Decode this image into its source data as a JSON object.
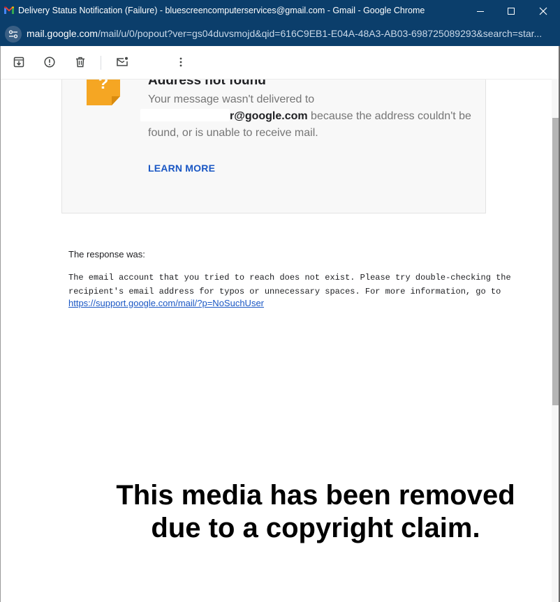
{
  "window": {
    "title": "Delivery Status Notification (Failure) - bluescreencomputerservices@gmail.com - Gmail - Google Chrome",
    "url_host": "mail.google.com",
    "url_path": "/mail/u/0/popout?ver=gs04duvsmojd&qid=616C9EB1-E04A-48A3-AB03-698725089293&search=star..."
  },
  "toolbar": {
    "buttons": [
      "archive-icon",
      "report-spam-icon",
      "delete-icon",
      "mark-unread-icon",
      "more-icon"
    ]
  },
  "card": {
    "title": "Address not found",
    "msg_before": "Your message wasn't delivered to",
    "email_partial": "r@google.com",
    "msg_after": " because the address couldn't be found, or is unable to receive mail.",
    "learn_more": "LEARN MORE"
  },
  "response": {
    "label": "The response was:",
    "body": "The email account that you tried to reach does not exist. Please try double-checking the recipient's email address for typos or unnecessary spaces. For more information, go to",
    "link": "https://support.google.com/mail/?p=NoSuchUser"
  },
  "overlay": {
    "notice": "This media has been removed due to a copyright claim."
  },
  "colors": {
    "titlebar": "#0b3e6b",
    "link": "#1a57c4",
    "card_bg": "#f8f8f8",
    "warning_icon": "#f5a623"
  }
}
